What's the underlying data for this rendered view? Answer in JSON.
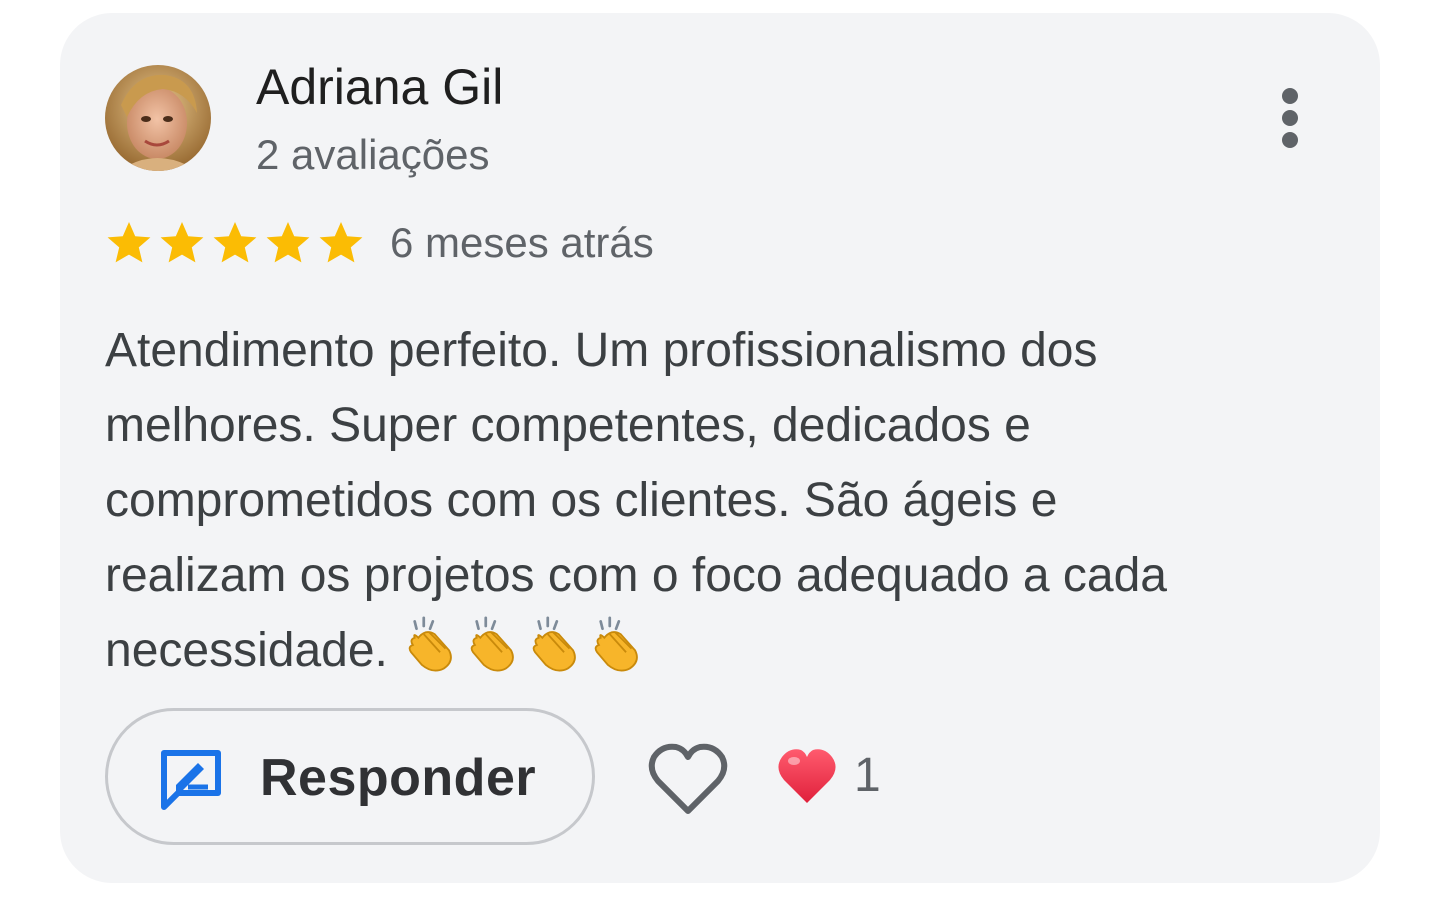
{
  "review": {
    "author_name": "Adriana Gil",
    "author_meta": "2 avaliações",
    "rating": 5,
    "rating_max": 5,
    "time_ago": "6 meses atrás",
    "text": "Atendimento perfeito. Um profissionalismo dos\nmelhores. Super competentes, dedicados e\ncomprometidos com os clientes. São ágeis e\nrealizam os projetos com o foco adequado a cada\nnecessidade.",
    "emoji": [
      "clapping-hands",
      "clapping-hands",
      "clapping-hands",
      "clapping-hands"
    ]
  },
  "actions": {
    "reply_label": "Responder",
    "reaction_count": "1"
  },
  "colors": {
    "card_background": "#f3f4f6",
    "star": "#fbbc04",
    "reply_icon": "#1a73e8",
    "heart_reaction": "#ea4335"
  },
  "icons": {
    "more": "more-vert-icon",
    "star": "star-icon",
    "reply": "reply-icon",
    "like": "heart-outline-icon",
    "reaction": "heart-filled-icon"
  }
}
